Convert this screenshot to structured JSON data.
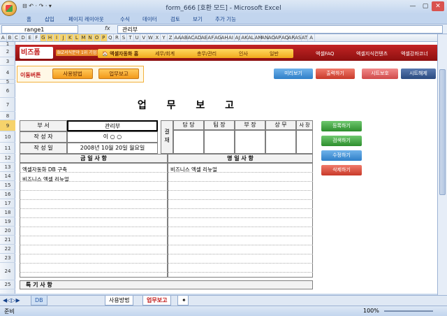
{
  "window": {
    "title": "form_666 [호환 모드] - Microsoft Excel",
    "qat": "⊟ ↶ · ↷ · ▾"
  },
  "ribbon_tabs": [
    "홈",
    "삽입",
    "페이지 레이아웃",
    "수식",
    "데이터",
    "검토",
    "보기",
    "추가 기능"
  ],
  "formula": {
    "name_box": "range1",
    "fx": "fx",
    "value": "관리부"
  },
  "columns": [
    "A",
    "B",
    "C",
    "D",
    "E",
    "F",
    "G",
    "H",
    "I",
    "J",
    "K",
    "L",
    "M",
    "N",
    "O",
    "P",
    "Q",
    "R",
    "S",
    "T",
    "U",
    "V",
    "W",
    "X",
    "Y",
    "Z",
    "AA",
    "AB",
    "AC",
    "AD",
    "AE",
    "AF",
    "AG",
    "AH",
    "AI",
    "AJ",
    "AK",
    "AL",
    "AM",
    "AN",
    "AO",
    "AP",
    "AQ",
    "AR",
    "AS",
    "AT",
    "A"
  ],
  "rows": [
    "1",
    "2",
    "3",
    "4",
    "5",
    "6",
    "7",
    "8",
    "9",
    "10",
    "11",
    "12",
    "13",
    "14",
    "15",
    "16",
    "17",
    "18",
    "19",
    "20",
    "21",
    "22",
    "23",
    "24",
    "25"
  ],
  "topbar": {
    "logo": "비즈폼",
    "logo_sub": "BIZ서식분야 1위 기업",
    "nav": [
      "🏠 엑셀자동화 홈",
      "세무/회계",
      "총무/관리",
      "인사",
      "일반"
    ],
    "links": [
      "엑셀FAQ",
      "엑셀지식컨텐츠",
      "엑셀강좌코너"
    ]
  },
  "move": {
    "label": "이동버튼",
    "btn1": "사용방법",
    "btn2": "업무보고"
  },
  "toolbar": {
    "preview": "미리보기",
    "print": "출력하기",
    "protect": "시트보호",
    "unprotect": "시트해제"
  },
  "report": {
    "title": "업 무 보 고",
    "dept_label": "부 서",
    "dept_value": "관리부",
    "author_label": "작 성 자",
    "author_value": "이 ○ ○",
    "date_label": "작 성 일",
    "date_value": "2008년 10월 20일 월요일",
    "approve_label": "결 재",
    "approvers": [
      "담 당",
      "팀 장",
      "부 장",
      "상 무",
      "사 장"
    ],
    "today_header": "금 일 사 항",
    "tomorrow_header": "명 일 사 항",
    "today_items": [
      "엑셀자동화 DB 구축",
      "비즈니스 엑셀 리뉴얼"
    ],
    "tomorrow_items": [
      "비즈니스 엑셀 리뉴얼"
    ],
    "notes_header": "특 기 사 항"
  },
  "side_buttons": {
    "register": "등록하기",
    "search": "검색하기",
    "edit": "수정하기",
    "delete": "삭제하기"
  },
  "sheet_tabs": [
    "DB",
    "사용방법",
    "업무보고"
  ],
  "status": {
    "left": "준비",
    "zoom": "100%"
  }
}
